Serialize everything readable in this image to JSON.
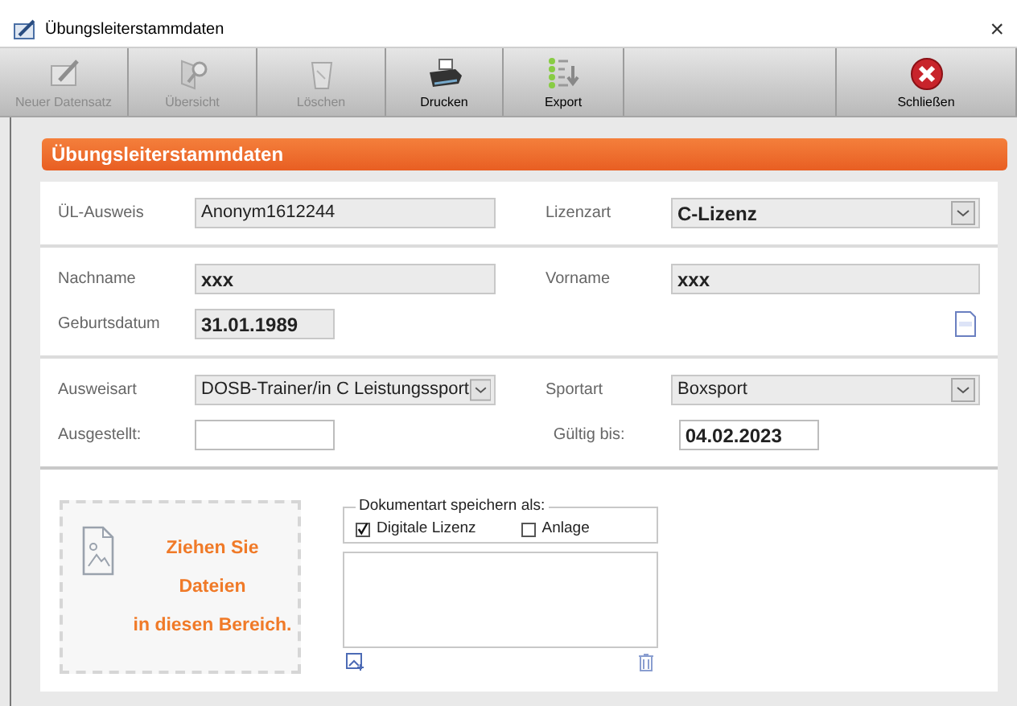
{
  "window": {
    "title": "Übungsleiterstammdaten",
    "close": "×"
  },
  "toolbar": {
    "buttons": [
      {
        "kind": "button",
        "label": "Neuer Datensatz",
        "disabled": true
      },
      {
        "kind": "button",
        "label": "Übersicht",
        "disabled": true
      },
      {
        "kind": "button",
        "label": "Löschen",
        "disabled": true
      },
      {
        "kind": "button",
        "label": "Drucken",
        "disabled": false
      },
      {
        "kind": "button",
        "label": "Export",
        "disabled": false
      },
      {
        "kind": "spacer"
      },
      {
        "kind": "button",
        "label": "Schließen",
        "disabled": false
      }
    ]
  },
  "header": {
    "title": "Übungsleiterstammdaten"
  },
  "sections": [
    {
      "rows": [
        {
          "left": {
            "label": "ÜL-Ausweis",
            "value": "Anonym1612244",
            "kind": "text",
            "readonly": true,
            "bold": false
          },
          "right": {
            "label": "Lizenzart",
            "value": "C-Lizenz",
            "kind": "select",
            "readonly": true,
            "bold": true
          }
        }
      ]
    },
    {
      "rows": [
        {
          "left": {
            "label": "Nachname",
            "value": "xxx",
            "kind": "text",
            "readonly": true,
            "bold": true
          },
          "right": {
            "label": "Vorname",
            "value": "xxx",
            "kind": "text",
            "readonly": true,
            "bold": true
          }
        },
        {
          "left": {
            "label": "Geburtsdatum",
            "value": "31.01.1989",
            "kind": "date",
            "readonly": true,
            "bold": true
          },
          "log": true
        }
      ]
    },
    {
      "rows": [
        {
          "left": {
            "label": "Ausweisart",
            "value": "DOSB-Trainer/in C Leistungssport",
            "kind": "select",
            "readonly": true,
            "bold": false
          },
          "right": {
            "label": "Sportart",
            "value": "Boxsport",
            "kind": "select",
            "readonly": true,
            "bold": false
          }
        },
        {
          "left": {
            "label": "Ausgestellt:",
            "kind": "date",
            "readonly": false
          },
          "right": {
            "label": "Gültig bis:",
            "value": "04.02.2023",
            "kind": "date",
            "readonly": false,
            "bold": true
          }
        }
      ]
    }
  ],
  "dropzone": {
    "lines": [
      "Ziehen Sie",
      "Dateien",
      "in diesen Bereich."
    ]
  },
  "document_type": {
    "legend": "Dokumentart speichern als:",
    "options": [
      {
        "label": "Digitale Lizenz",
        "checked": true
      },
      {
        "label": "Anlage",
        "checked": false
      }
    ]
  }
}
